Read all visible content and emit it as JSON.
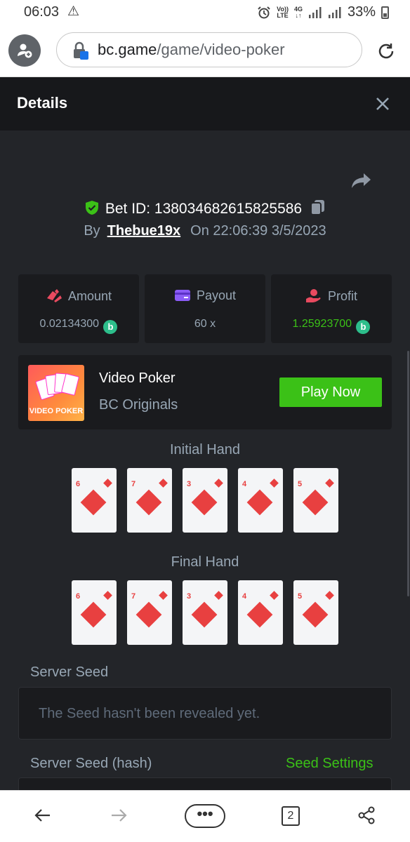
{
  "status_bar": {
    "time": "06:03",
    "volte_top": "Vo))",
    "volte_bottom": "LTE",
    "net_top": "4G",
    "net_bottom": "↓↑",
    "battery": "33%"
  },
  "browser": {
    "url_domain": "bc.game",
    "url_path": "/game/video-poker",
    "tab_count": "2",
    "menu_label": "•••"
  },
  "modal": {
    "title": "Details",
    "bet_id_label": "Bet ID: ",
    "bet_id": "138034682615825586",
    "by_label": "By",
    "username": "Thebue19x",
    "on_label": "On",
    "timestamp": "22:06:39 3/5/2023"
  },
  "stats": {
    "amount": {
      "label": "Amount",
      "value": "0.02134300",
      "color": "#e84a5f"
    },
    "payout": {
      "label": "Payout",
      "value": "60 x",
      "color": "#8b5cf6"
    },
    "profit": {
      "label": "Profit",
      "value": "1.25923700",
      "color": "#e84a5f"
    },
    "coin_glyph": "b"
  },
  "game": {
    "name": "Video Poker",
    "provider": "BC Originals",
    "thumb_label": "VIDEO POKER",
    "play_label": "Play Now"
  },
  "hands": {
    "initial_label": "Initial Hand",
    "final_label": "Final Hand",
    "initial": [
      "6",
      "7",
      "3",
      "4",
      "5"
    ],
    "final": [
      "6",
      "7",
      "3",
      "4",
      "5"
    ],
    "suit": "diamonds"
  },
  "seed": {
    "server_seed_label": "Server Seed",
    "server_seed_value": "The Seed hasn't been revealed yet.",
    "server_seed_hash_label": "Server Seed (hash)",
    "seed_settings_label": "Seed Settings"
  },
  "colors": {
    "accent_green": "#3bc117",
    "card_red": "#e84040",
    "panel_bg": "#232529"
  }
}
